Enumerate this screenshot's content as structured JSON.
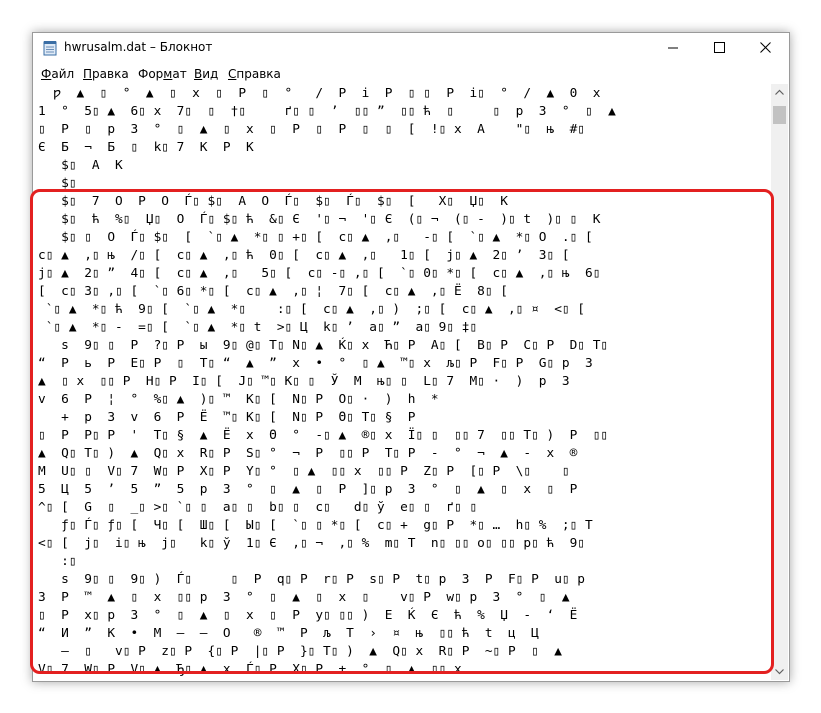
{
  "window": {
    "title": "hwrusalm.dat – Блокнот"
  },
  "menu": {
    "file": {
      "accel": "Ф",
      "rest": "айл"
    },
    "edit": {
      "accel": "П",
      "rest": "равка"
    },
    "format": {
      "pre": "Фор",
      "accel": "м",
      "rest": "ат"
    },
    "view": {
      "accel": "В",
      "rest": "ид"
    },
    "help": {
      "accel": "С",
      "rest": "правка"
    }
  },
  "colors": {
    "highlight": "#e32020",
    "scrollbar_track": "#f0f0f0",
    "scrollbar_thumb": "#c2c2c2"
  },
  "icons": [
    "notepad-app-icon",
    "minimize-icon",
    "maximize-icon",
    "close-icon",
    "scroll-up-arrow-icon",
    "scroll-down-arrow-icon"
  ],
  "editor": {
    "lines": [
      "  ƿ  ▲  ▯  °  ▲  ▯  x  ▯  P  ▯  °   /  P  i  P  ▯ ▯  P  i▯  °  /  ▲  0  x",
      "1  °  5▯ ▲  6▯ x  7▯  ▯  †▯     ґ▯ ▯  ’  ▯▯ ”  ▯▯ ћ  ▯     ▯  р  3  °  ▯  ▲",
      "▯  P  ▯  р  3  °  ▯  ▲  ▯  x  ▯  P  ▯  P  ▯  ▯  [  !▯ x  A    \"▯  њ  #▯",
      "Є  Б  ¬  Б  ▯  k▯ 7  K  P  K",
      "   $▯  A  K",
      "   $▯",
      "   $▯  7  O  P  O  Ѓ▯ $▯  A  O  Ѓ▯  $▯  Ѓ▯  $▯  [   X▯  Џ▯  K",
      "   $▯  ћ  %▯  Џ▯  O  Ѓ▯ $▯ ћ  &▯ Є  '▯ ¬  '▯ Є  (▯ ¬  (▯ -  )▯ t  )▯ ▯  K",
      "   $▯ ▯  O  Ѓ▯ $▯  [  `▯ ▲  *▯ ▯ +▯ [  c▯ ▲  ,▯   -▯ [  `▯ ▲  *▯ O  .▯ [",
      "c▯ ▲  ,▯ њ  /▯ [  c▯ ▲  ,▯ ћ  0▯ [  c▯ ▲  ,▯   1▯ [  j▯ ▲  2▯ ’  3▯ [",
      "j▯ ▲  2▯ ”  4▯ [  c▯ ▲  ,▯   5▯ [  c▯ -▯ ,▯ [  `▯ 0▯ *▯ [  c▯ ▲  ,▯ њ  6▯",
      "[  c▯ 3▯ ,▯ [  `▯ 6▯ *▯ [  c▯ ▲  ,▯ ¦  7▯ [  c▯ ▲  ,▯ Ё  8▯ [",
      " `▯ ▲  *▯ ћ  9▯ [  `▯ ▲  *▯    :▯ [  c▯ ▲  ,▯ )  ;▯ [  c▯ ▲  ,▯ ¤  <▯ [",
      " `▯ ▲  *▯ -  =▯ [  `▯ ▲  *▯ t  >▯ Ц  k▯ ’  a▯ ”  a▯ 9▯ ‡▯",
      "   s  9▯ ▯  P  ?▯ P  ы  9▯ @▯ T▯ N▯ ▲  Ќ▯ x  Ћ▯ P  A▯ [  B▯ P  C▯ P  D▯ T▯",
      "“  P  ь  P  E▯ P  ▯  T▯ “  ▲  ”  x  •  °  ▯ ▲  ™▯ x  љ▯ P  F▯ P  G▯ р  3",
      "▲  ▯ x  ▯▯ P  H▯ P  I▯ [  J▯ ™▯ K▯ ▯  Ў  M  њ▯ ▯  L▯ 7  M▯ ·  )  р  3",
      "v  6  P  ¦  °  %▯ ▲  )▯ ™  K▯ [  N▯ P  O▯ ·  )  h  *",
      "   +  р  3  v  6  P  Ё  ™▯ K▯ [  N▯ P  Θ▯ T▯ §  P",
      "▯  P  P▯ P  '  T▯ §  ▲  Ё  x  Θ  °  -▯ ▲  ®▯ x  Ї▯ ▯  ▯▯ 7  ▯▯ T▯ )  P  ▯▯",
      "▲  Q▯ T▯ )  ▲  Q▯ x  R▯ P  S▯ °  ¬  P  ▯▯ P  T▯ P  -  °  ¬  ▲  -  x  ®",
      "M  U▯ ▯  V▯ 7  W▯ P  X▯ P  Y▯ °  ▯ ▲  ▯▯ x  ▯▯ P  Z▯ P  [▯ P  \\▯    ▯",
      "5  Ц  5  ’  5  ”  5  р  3  °  ▯  ▲  ▯  P  ]▯ р  3  °  ▯  ▲  ▯  x  ▯  P",
      "^▯ [  G  ▯  _▯ >▯ `▯ ▯  a▯ ▯  b▯ ▯  c▯   d▯ ў  e▯ ▯  ґ▯ ▯",
      "   ƒ▯ Ѓ▯ ƒ▯ [  Ч▯ [  Ш▯ [  Ы▯ [  `▯ ▯ *▯ [  c▯ +  g▯ P  *▯ …  h▯ %  ;▯ T",
      "<▯ [  j▯  i▯ њ  j▯   k▯ ў  1▯ Є  ,▯ ¬  ,▯ %  m▯ T  n▯ ▯▯ o▯ ▯▯ р▯ ћ  9▯",
      "   :▯",
      "   s  9▯ ▯  9▯ )  Ѓ▯     ▯  P  q▯ P  r▯ P  s▯ P  t▯ р  3  P  F▯ P  u▯ р",
      "3  P  ™  ▲  ▯  x  ▯▯ р  3  °  ▯  ▲  ▯  x  ▯    v▯ P  w▯ р  3  °  ▯  ▲",
      "▯  P  x▯ р  3  °  ▯  ▲  ▯  x  ▯  P  y▯ ▯▯ )  E  Ќ  Є  ћ  %  Џ  -  ‘  Ё",
      "“  И  ”  K  •  M  –  —  O   ®  ™  P  љ  T  ›  ¤  њ  ▯▯ ћ  t  ц  Ц",
      "   –  ▯   v▯ P  z▯ P  {▯ P  |▯ P  }▯ T▯ )  ▲  Q▯ x  R▯ P  ~▯ P  ▯  ▲",
      "V▯ 7  W▯ P  V▯ ▲  Ђ▯ ▲  x  Ѓ▯ P  X▯ P  ±  °  ▯  ▲  ▯▯ x"
    ]
  }
}
